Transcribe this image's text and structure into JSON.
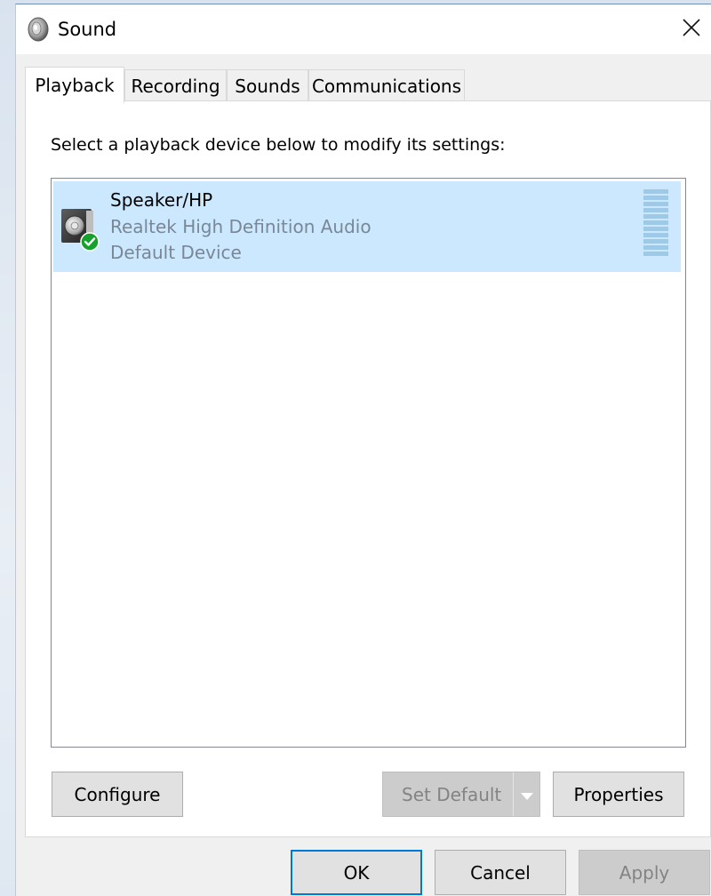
{
  "window": {
    "title": "Sound",
    "app_icon": "speaker-icon",
    "close_icon": "close-icon"
  },
  "tabs": [
    {
      "label": "Playback",
      "active": true
    },
    {
      "label": "Recording",
      "active": false
    },
    {
      "label": "Sounds",
      "active": false
    },
    {
      "label": "Communications",
      "active": false
    }
  ],
  "playback": {
    "instruction": "Select a playback device below to modify its settings:",
    "devices": [
      {
        "name": "Speaker/HP",
        "driver": "Realtek High Definition Audio",
        "status": "Default Device",
        "icon": "speaker-device-icon",
        "status_icon": "check-icon",
        "selected": true
      }
    ],
    "buttons": {
      "configure": "Configure",
      "set_default": "Set Default",
      "properties": "Properties"
    }
  },
  "dialog_buttons": {
    "ok": "OK",
    "cancel": "Cancel",
    "apply": "Apply"
  },
  "colors": {
    "selection": "#cce8ff",
    "accent": "#0078d7",
    "default_check": "#16a12d",
    "meter": "#9ecae8"
  }
}
